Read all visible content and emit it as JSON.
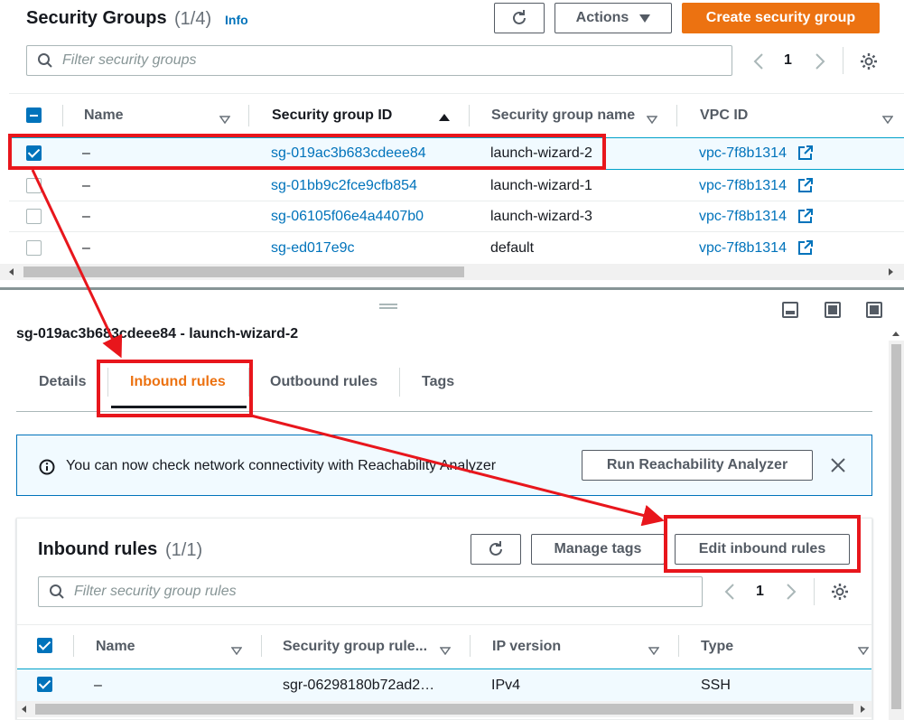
{
  "top": {
    "title": "Security Groups",
    "count": "(1/4)",
    "info": "Info",
    "actions_label": "Actions",
    "create_label": "Create security group",
    "filter_placeholder": "Filter security groups",
    "page": "1"
  },
  "sg_table": {
    "columns": [
      "Name",
      "Security group ID",
      "Security group name",
      "VPC ID"
    ],
    "rows": [
      {
        "name": "–",
        "id": "sg-019ac3b683cdeee84",
        "group_name": "launch-wizard-2",
        "vpc": "vpc-7f8b1314",
        "checked": true
      },
      {
        "name": "–",
        "id": "sg-01bb9c2fce9cfb854",
        "group_name": "launch-wizard-1",
        "vpc": "vpc-7f8b1314",
        "checked": false
      },
      {
        "name": "–",
        "id": "sg-06105f06e4a4407b0",
        "group_name": "launch-wizard-3",
        "vpc": "vpc-7f8b1314",
        "checked": false
      },
      {
        "name": "–",
        "id": "sg-ed017e9c",
        "group_name": "default",
        "vpc": "vpc-7f8b1314",
        "checked": false
      }
    ]
  },
  "detail": {
    "title": "sg-019ac3b683cdeee84 - launch-wizard-2",
    "tabs": [
      "Details",
      "Inbound rules",
      "Outbound rules",
      "Tags"
    ],
    "active_tab": "Inbound rules"
  },
  "alert": {
    "text": "You can now check network connectivity with Reachability Analyzer",
    "button": "Run Reachability Analyzer"
  },
  "inbound": {
    "title": "Inbound rules",
    "count": "(1/1)",
    "manage_tags": "Manage tags",
    "edit_rules": "Edit inbound rules",
    "filter_placeholder": "Filter security group rules",
    "page": "1",
    "columns": [
      "Name",
      "Security group rule...",
      "IP version",
      "Type"
    ],
    "rows": [
      {
        "name": "–",
        "rule": "sgr-06298180b72ad2…",
        "ip": "IPv4",
        "type": "SSH",
        "checked": true
      }
    ]
  },
  "colors": {
    "accent": "#ec7211",
    "link": "#0073bb",
    "highlight": "#e8161c"
  }
}
